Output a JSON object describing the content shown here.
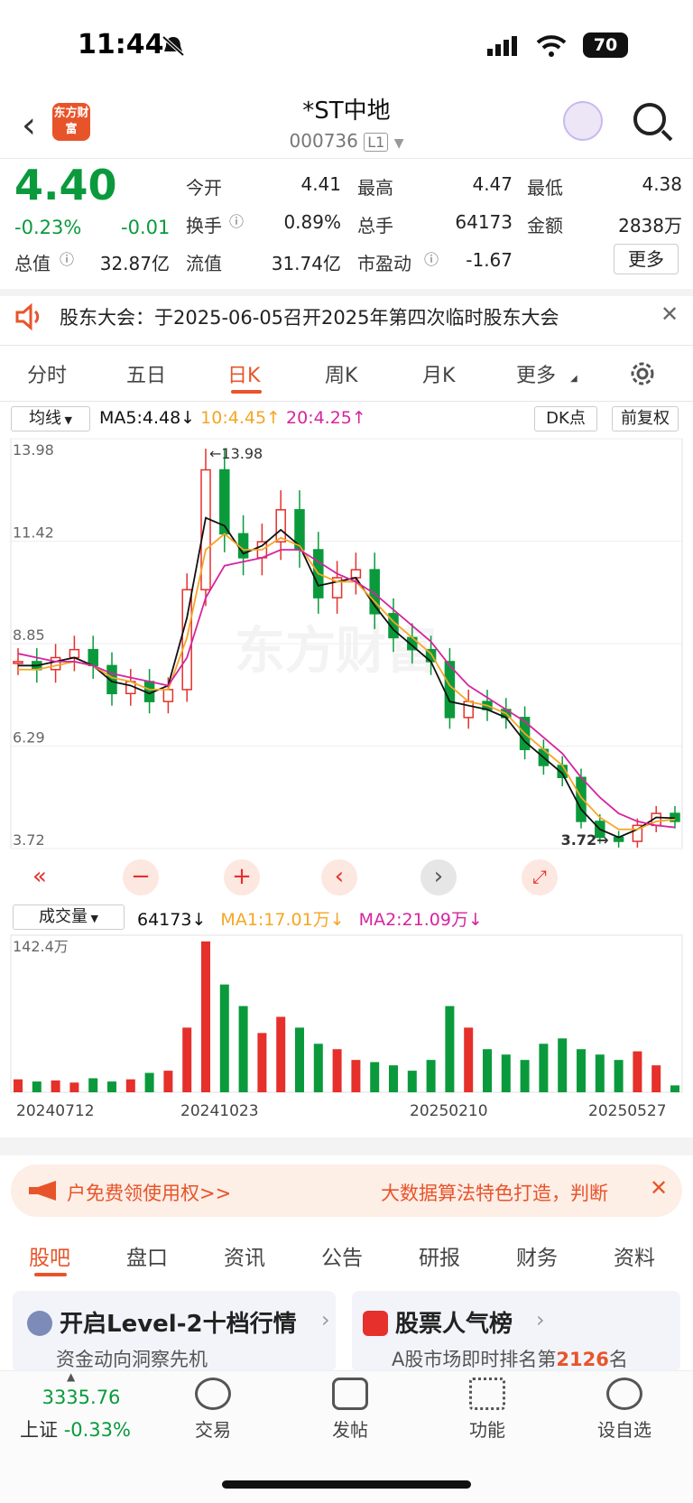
{
  "status_bar": {
    "time": "11:44",
    "battery": "70"
  },
  "header": {
    "title": "*ST中地",
    "code": "000736",
    "level": "L1",
    "logo": "东方财富"
  },
  "quote": {
    "price": "4.40",
    "change_pct": "-0.23%",
    "change": "-0.01",
    "fields": [
      {
        "label": "今开",
        "value": "4.41"
      },
      {
        "label": "最高",
        "value": "4.47"
      },
      {
        "label": "最低",
        "value": "4.38"
      },
      {
        "label": "换手",
        "value": "0.89%"
      },
      {
        "label": "总手",
        "value": "64173"
      },
      {
        "label": "金额",
        "value": "2838万"
      },
      {
        "label": "总值",
        "value": "32.87亿"
      },
      {
        "label": "流值",
        "value": "31.74亿"
      },
      {
        "label": "市盈动",
        "value": "-1.67"
      }
    ],
    "more": "更多"
  },
  "notice": {
    "text": "股东大会：于2025-06-05召开2025年第四次临时股东大会"
  },
  "tabs": [
    "分时",
    "五日",
    "日K",
    "周K",
    "月K",
    "更多"
  ],
  "kline": {
    "indicator": "均线",
    "ma5": "MA5:4.48↓",
    "ma10": "10:4.45↑",
    "ma20": "20:4.25↑",
    "dk": "DK点",
    "adjust": "前复权",
    "high_marker": "←13.98",
    "low_marker": "3.72→",
    "watermark": "东方财富"
  },
  "volume": {
    "indicator": "成交量",
    "value": "64173↓",
    "ma1": "MA1:17.01万↓",
    "ma2": "MA2:21.09万↓",
    "max_label": "142.4万"
  },
  "chart_data": [
    {
      "type": "candlestick",
      "ylim": [
        3.72,
        13.98
      ],
      "y_ticks": [
        "13.98",
        "11.42",
        "8.85",
        "6.29",
        "3.72"
      ],
      "x_ticks": [
        "20240712",
        "20241023",
        "20250210",
        "20250527"
      ],
      "close_trend": [
        8.4,
        8.2,
        8.5,
        8.7,
        8.3,
        7.6,
        7.9,
        7.4,
        7.7,
        10.2,
        13.2,
        11.6,
        11.0,
        11.4,
        12.2,
        11.2,
        10.0,
        10.5,
        10.7,
        9.6,
        9.0,
        8.7,
        8.4,
        7.0,
        7.4,
        7.2,
        7.0,
        6.2,
        5.8,
        5.5,
        4.4,
        4.0,
        3.9,
        4.3,
        4.6,
        4.4
      ],
      "series": [
        {
          "name": "MA5",
          "values": [
            8.3,
            8.3,
            8.4,
            8.5,
            8.3,
            7.9,
            7.8,
            7.6,
            7.8,
            9.5,
            12.0,
            11.8,
            11.1,
            11.3,
            11.7,
            11.3,
            10.3,
            10.4,
            10.5,
            9.8,
            9.2,
            8.8,
            8.4,
            7.4,
            7.3,
            7.2,
            7.0,
            6.4,
            6.0,
            5.6,
            4.7,
            4.2,
            4.0,
            4.2,
            4.5,
            4.48
          ]
        },
        {
          "name": "MA10",
          "values": [
            8.2,
            8.2,
            8.3,
            8.4,
            8.3,
            8.0,
            7.9,
            7.7,
            7.7,
            9.0,
            11.2,
            11.6,
            11.2,
            11.2,
            11.5,
            11.3,
            10.6,
            10.4,
            10.4,
            9.9,
            9.4,
            9.0,
            8.6,
            7.8,
            7.4,
            7.3,
            7.1,
            6.6,
            6.2,
            5.8,
            5.0,
            4.5,
            4.2,
            4.2,
            4.4,
            4.45
          ]
        },
        {
          "name": "MA20",
          "values": [
            8.6,
            8.5,
            8.4,
            8.4,
            8.3,
            8.1,
            8.0,
            7.9,
            7.8,
            8.5,
            10.0,
            10.8,
            10.9,
            11.0,
            11.2,
            11.2,
            10.9,
            10.6,
            10.4,
            10.1,
            9.7,
            9.3,
            8.9,
            8.3,
            7.8,
            7.5,
            7.2,
            6.9,
            6.5,
            6.1,
            5.5,
            5.0,
            4.6,
            4.4,
            4.3,
            4.25
          ]
        }
      ]
    },
    {
      "type": "bar",
      "ylim": [
        0,
        142.4
      ],
      "ylabel_unit": "万",
      "values": [
        12,
        10,
        11,
        9,
        13,
        10,
        12,
        18,
        20,
        60,
        140,
        100,
        80,
        55,
        70,
        60,
        45,
        40,
        30,
        28,
        25,
        20,
        30,
        80,
        60,
        40,
        35,
        30,
        45,
        50,
        40,
        35,
        30,
        38,
        25,
        6.4
      ]
    }
  ],
  "ad": {
    "left": "户免费领使用权>>",
    "right": "大数据算法特色打造，判断"
  },
  "subtabs": [
    "股吧",
    "盘口",
    "资讯",
    "公告",
    "研报",
    "财务",
    "资料"
  ],
  "cards": [
    {
      "title": "开启Level-2十档行情",
      "sub": "资金动向洞察先机"
    },
    {
      "title": "股票人气榜",
      "sub_prefix": "A股市场即时排名第",
      "rank": "2126",
      "sub_suffix": "名"
    }
  ],
  "bottom_nav": {
    "index_value": "3335.76",
    "index_name": "上证",
    "index_pct": "-0.33%",
    "items": [
      "交易",
      "发帖",
      "功能",
      "设自选"
    ]
  },
  "colors": {
    "up": "#e5302b",
    "down": "#0a9a3c",
    "accent": "#e8542a",
    "ma5": "#111111",
    "ma10": "#f5a623",
    "ma20": "#d6249f"
  }
}
